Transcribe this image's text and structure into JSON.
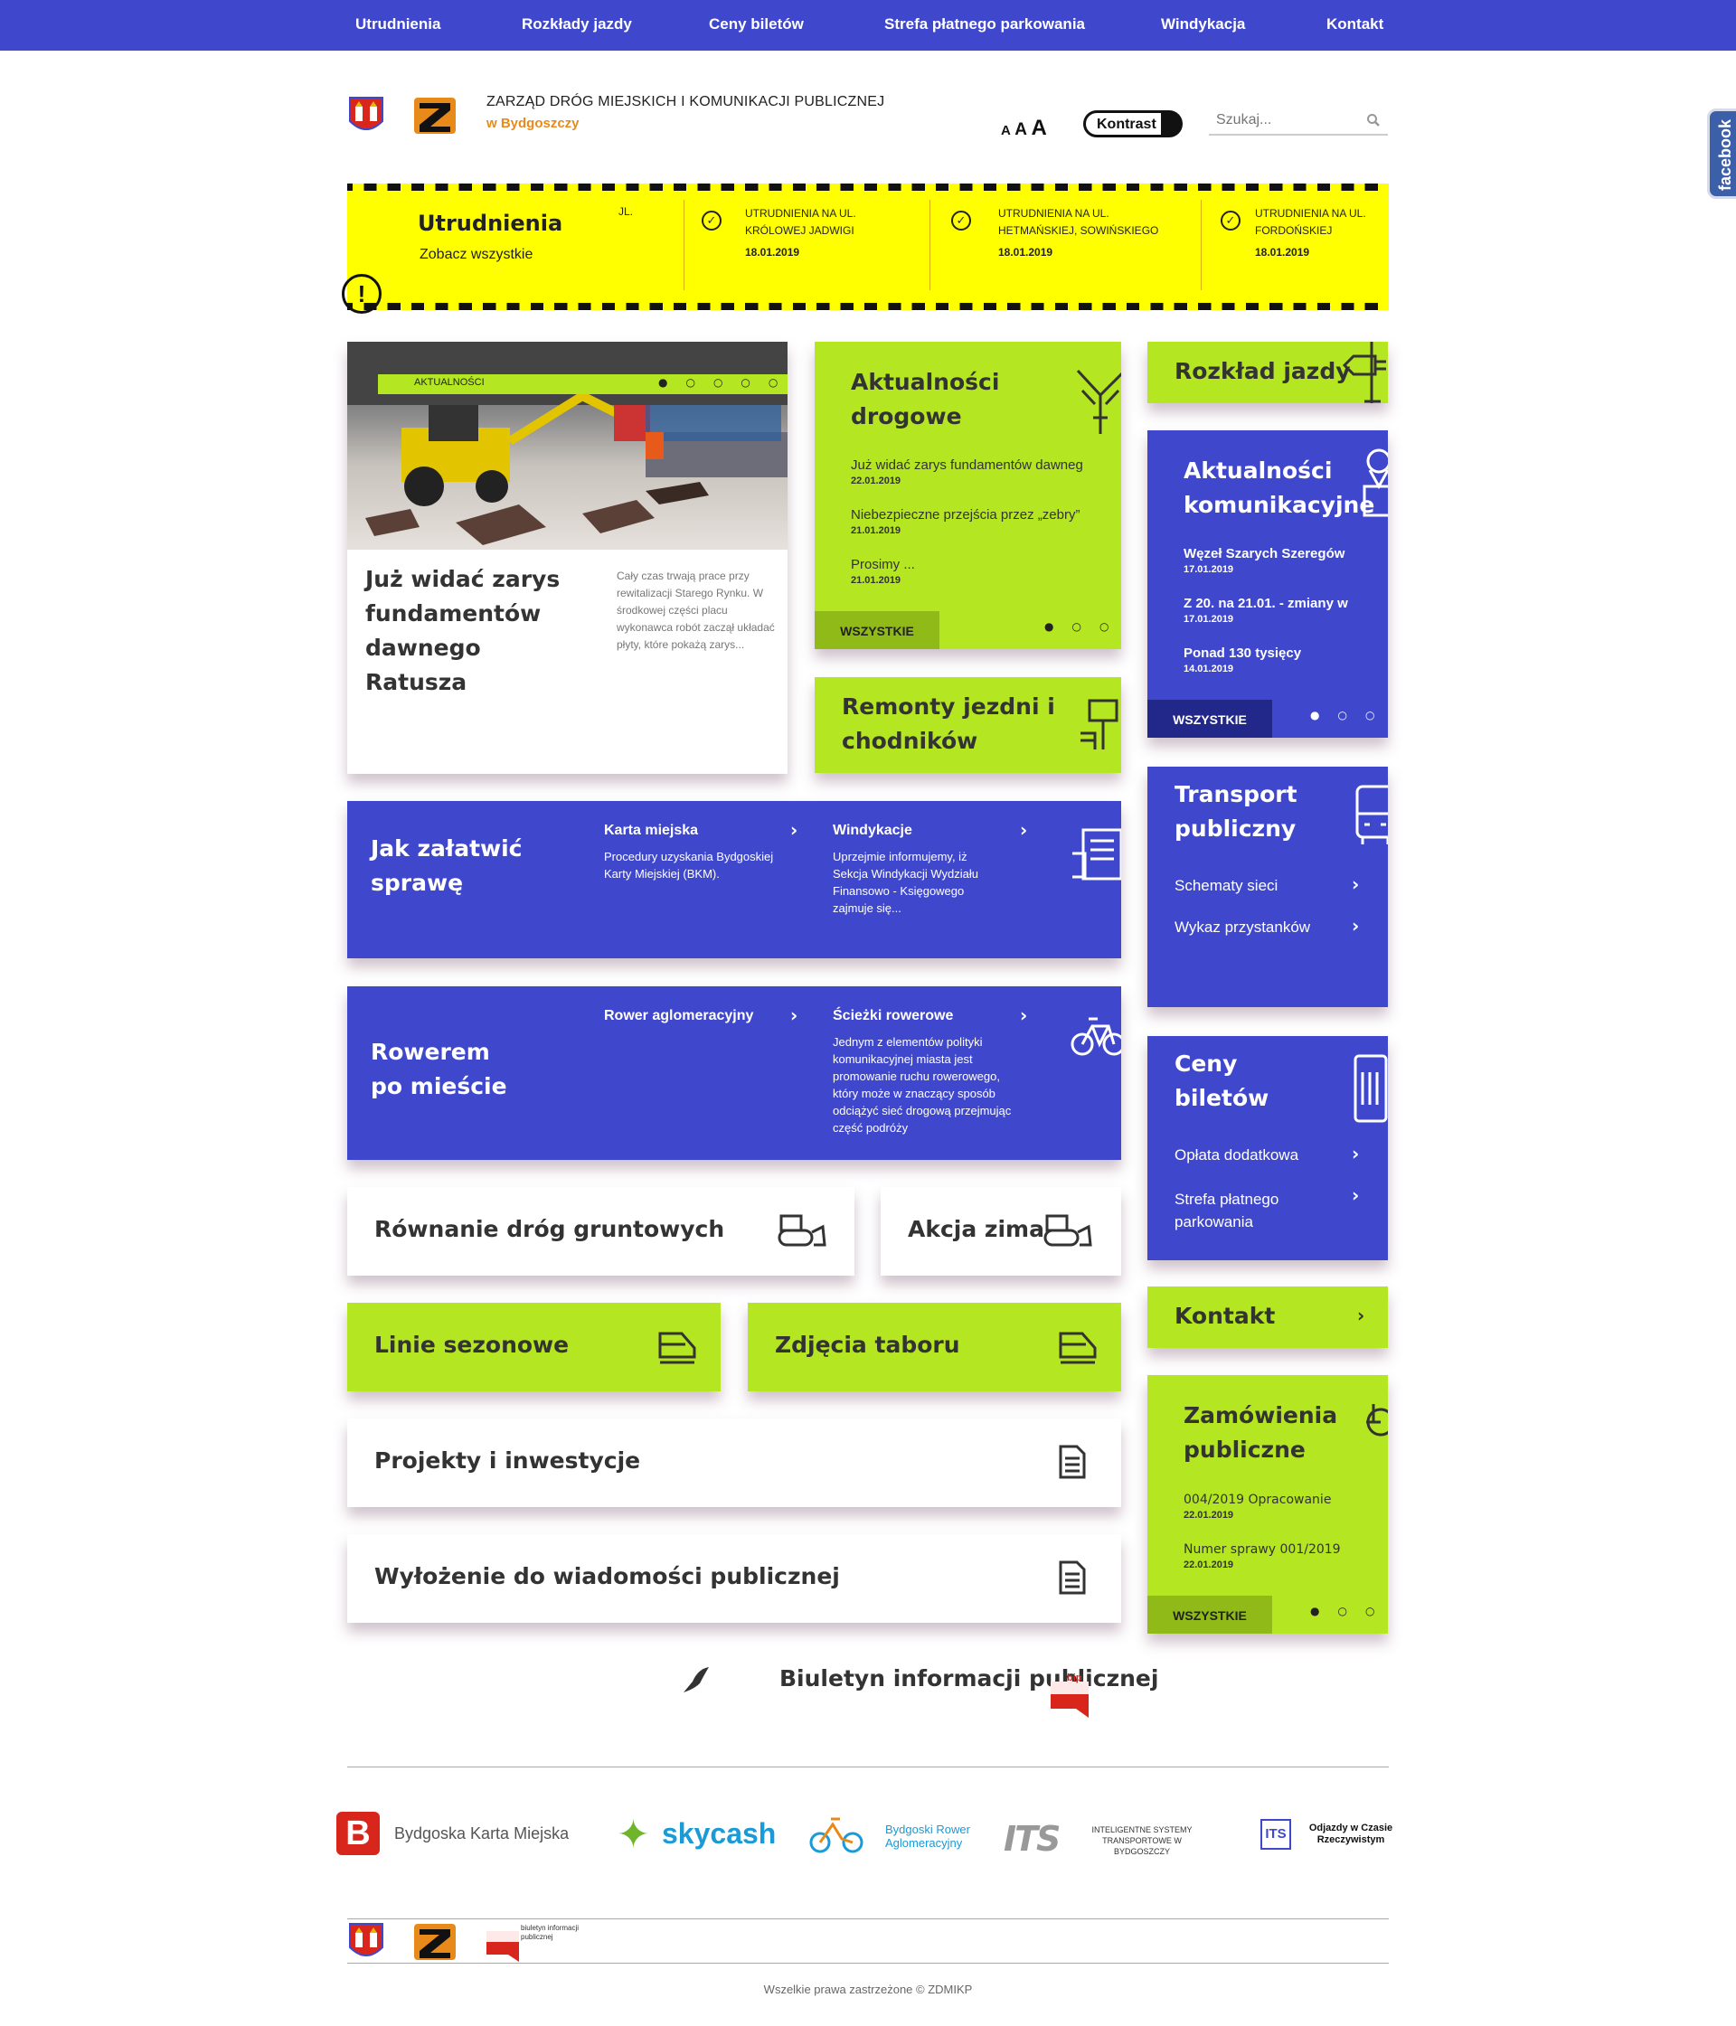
{
  "nav": [
    "Utrudnienia",
    "Rozkłady jazdy",
    "Ceny biletów",
    "Strefa płatnego parkowania",
    "Windykacja",
    "Kontakt"
  ],
  "header": {
    "title": "ZARZĄD DRÓG MIEJSKICH I KOMUNIKACJI PUBLICZNEJ",
    "subtitle": "w Bydgoszczy",
    "font_small": "A",
    "font_medium": "A",
    "font_large": "A",
    "contrast": "Kontrast",
    "search_placeholder": "Szukaj...",
    "facebook": "facebook"
  },
  "alert": {
    "title": "Utrudnienia",
    "see_all": "Zobacz wszystkie",
    "partial": "JL.",
    "items": [
      {
        "text": "UTRUDNIENIA NA UL. KRÓLOWEJ JADWIGI",
        "date": "18.01.2019"
      },
      {
        "text": "UTRUDNIENIA NA UL. HETMAŃSKIEJ, SOWIŃSKIEGO",
        "date": "18.01.2019"
      },
      {
        "text": "UTRUDNIENIA NA UL. FORDOŃSKIEJ",
        "date": "18.01.2019"
      }
    ]
  },
  "feature": {
    "tag": "AKTUALNOŚCI",
    "headline": "Już widać zarys fundamentów dawnego Ratusza",
    "excerpt": "Cały czas trwają prace przy rewitalizacji Starego Rynku. W środkowej części placu wykonawca robót zaczął układać płyty, które pokażą zarys..."
  },
  "road_news": {
    "title": "Aktualności drogowe",
    "items": [
      {
        "text": "Już widać zarys fundamentów dawnego",
        "date": "22.01.2019"
      },
      {
        "text": "Niebezpieczne przejścia przez „zebry”",
        "date": "21.01.2019"
      },
      {
        "text": "Prosimy ...",
        "date": "21.01.2019"
      }
    ],
    "all": "WSZYSTKIE"
  },
  "repairs": {
    "title": "Remonty jezdni i chodników"
  },
  "timetable": {
    "title": "Rozkład jazdy"
  },
  "transport_news": {
    "title": "Aktualności komunikacyjne",
    "items": [
      {
        "text": "Węzeł Szarych Szeregów",
        "date": "17.01.2019"
      },
      {
        "text": "Z 20. na 21.01. - zmiany w",
        "date": "17.01.2019"
      },
      {
        "text": "Ponad 130 tysięcy",
        "date": "14.01.2019"
      }
    ],
    "all": "WSZYSTKIE"
  },
  "how_to": {
    "title": "Jak załatwić sprawę",
    "col1_title": "Karta miejska",
    "col1_text": "Procedury uzyskania Bydgoskiej Karty Miejskiej (BKM).",
    "col2_title": "Windykacje",
    "col2_text": "Uprzejmie informujemy, iż Sekcja Windykacji Wydziału Finansowo - Księgowego zajmuje się..."
  },
  "transport": {
    "title": "Transport publiczny",
    "links": [
      "Schematy sieci",
      "Wykaz przystanków"
    ]
  },
  "bike": {
    "title": "Rowerem po mieście",
    "col1_title": "Rower aglomeracyjny",
    "col2_title": "Ścieżki rowerowe",
    "col2_text": "Jednym z elementów polityki komunikacyjnej miasta jest promowanie ruchu rowerowego, który może w znaczący sposób odciążyć sieć drogową przejmując część podróży"
  },
  "tickets": {
    "title": "Ceny biletów",
    "links": [
      "Opłata dodatkowa",
      "Strefa płatnego parkowania"
    ]
  },
  "tiles": {
    "grading": "Równanie dróg gruntowych",
    "winter": "Akcja zima",
    "seasonal": "Linie sezonowe",
    "fleet": "Zdjęcia taboru",
    "projects": "Projekty i inwestycje",
    "publication": "Wyłożenie do wiadomości publicznej"
  },
  "contact": {
    "title": "Kontakt"
  },
  "procurement": {
    "title": "Zamówienia publiczne",
    "items": [
      {
        "text": "004/2019 Opracowanie",
        "date": "22.01.2019"
      },
      {
        "text": "Numer sprawy 001/2019",
        "date": "22.01.2019"
      }
    ],
    "all": "WSZYSTKIE"
  },
  "bip": {
    "title": "Biuletyn informacji publicznej",
    "logo_text": "bip",
    "footer_logo_text": "biuletyn informacji publicznej"
  },
  "partners": {
    "bkm": "Bydgoska Karta Miejska",
    "bkm_logo": "B",
    "skycash": "skycash",
    "bra": "Bydgoski Rower Aglomeracyjny",
    "its_logo": "ITS",
    "its": "INTELIGENTNE SYSTEMY TRANSPORTOWE W BYDGOSZCZY",
    "odjazdy_logo": "ITS",
    "odjazdy": "Odjazdy w Czasie Rzeczywistym"
  },
  "footer": {
    "copyright": "Wszelkie prawa zastrzeżone © ZDMIKP"
  },
  "colors": {
    "nav": "#3f48cc",
    "lime": "#b4e622",
    "alert": "#ffff00",
    "accent": "#e88a1a"
  }
}
